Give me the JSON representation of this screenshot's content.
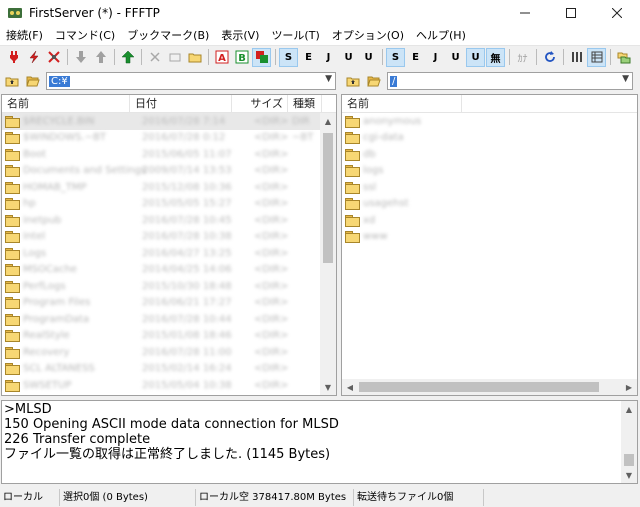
{
  "window": {
    "title": "FirstServer (*) - FFFTP"
  },
  "menu": [
    "接続(F)",
    "コマンド(C)",
    "ブックマーク(B)",
    "表示(V)",
    "ツール(T)",
    "オプション(O)",
    "ヘルプ(H)"
  ],
  "toolbar": {
    "colors": {
      "red": "#d21f1f",
      "green": "#1a8f2e",
      "blue": "#2355c2",
      "accent": "#cce4f7"
    },
    "btn_a": "A",
    "btn_b": "B",
    "s_label": "S",
    "e_label": "E",
    "j_label": "J",
    "u_label": "U",
    "kanji_button": "無",
    "kana_button": "ｶﾅ"
  },
  "local": {
    "path": "C:¥",
    "columns": {
      "name": "名前",
      "date": "日付",
      "size": "サイズ",
      "kind": "種類"
    },
    "rows": [
      {
        "name": "$RECYCLE.BIN",
        "date": "2016/07/28 7:14",
        "size": "<DIR>",
        "kind": "DIR"
      },
      {
        "name": "$WINDOWS.~BT",
        "date": "2016/07/28 0:12",
        "size": "<DIR>",
        "kind": "~BT"
      },
      {
        "name": "Boot",
        "date": "2015/06/05 11:07",
        "size": "<DIR>",
        "kind": ""
      },
      {
        "name": "Documents and Settings",
        "date": "2009/07/14 13:53",
        "size": "<DIR>",
        "kind": ""
      },
      {
        "name": "HOMAB_TMP",
        "date": "2015/12/08 10:36",
        "size": "<DIR>",
        "kind": ""
      },
      {
        "name": "hp",
        "date": "2015/05/05 15:27",
        "size": "<DIR>",
        "kind": ""
      },
      {
        "name": "Inetpub",
        "date": "2016/07/28 10:45",
        "size": "<DIR>",
        "kind": ""
      },
      {
        "name": "Intel",
        "date": "2016/07/28 10:38",
        "size": "<DIR>",
        "kind": ""
      },
      {
        "name": "Logs",
        "date": "2016/04/27 13:25",
        "size": "<DIR>",
        "kind": ""
      },
      {
        "name": "MSOCache",
        "date": "2014/04/25 14:06",
        "size": "<DIR>",
        "kind": ""
      },
      {
        "name": "PerfLogs",
        "date": "2015/10/30 18:48",
        "size": "<DIR>",
        "kind": ""
      },
      {
        "name": "Program Files",
        "date": "2016/06/21 17:27",
        "size": "<DIR>",
        "kind": ""
      },
      {
        "name": "ProgramData",
        "date": "2016/07/28 10:44",
        "size": "<DIR>",
        "kind": ""
      },
      {
        "name": "RealStyle",
        "date": "2015/01/08 18:46",
        "size": "<DIR>",
        "kind": ""
      },
      {
        "name": "Recovery",
        "date": "2016/07/28 11:00",
        "size": "<DIR>",
        "kind": ""
      },
      {
        "name": "SCL ALTANESS",
        "date": "2015/02/14 16:24",
        "size": "<DIR>",
        "kind": ""
      },
      {
        "name": "SWSETUP",
        "date": "2015/05/04 10:38",
        "size": "<DIR>",
        "kind": ""
      }
    ]
  },
  "remote": {
    "path": "/",
    "columns": {
      "name": "名前"
    },
    "rows": [
      "anonymous",
      "cgi-data",
      "db",
      "logs",
      "ssl",
      "usagehst",
      "xd",
      "www"
    ]
  },
  "log": {
    "lines": [
      ">MLSD",
      "150 Opening ASCII mode data connection for MLSD",
      "226 Transfer complete",
      "ファイル一覧の取得は正常終了しました. (1145 Bytes)"
    ]
  },
  "status": {
    "local": "ローカル",
    "selected": "選択0個 (0 Bytes)",
    "free": "ローカル空 378417.80M Bytes",
    "queue": "転送待ちファイル0個"
  }
}
